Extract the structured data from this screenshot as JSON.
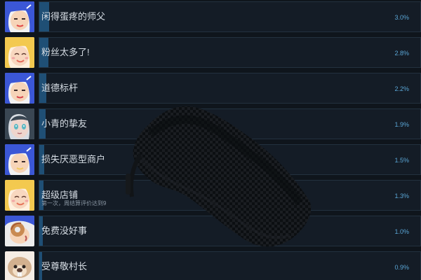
{
  "achievements": [
    {
      "title": "闲得蛋疼的师父",
      "description": "",
      "percent_label": "3.0%",
      "percent": 3.0,
      "avatar_icon": "blue-hair-girl-avatar",
      "hair_color": "#3b57d6",
      "skin_color": "#f6d4b8",
      "accent_color": "#e04646"
    },
    {
      "title": "粉丝太多了!",
      "description": "",
      "percent_label": "2.8%",
      "percent": 2.8,
      "avatar_icon": "blonde-girl-avatar",
      "hair_color": "#f3c94f",
      "skin_color": "#f8d7bf",
      "accent_color": "#e46a5a"
    },
    {
      "title": "道德标杆",
      "description": "",
      "percent_label": "2.2%",
      "percent": 2.2,
      "avatar_icon": "blue-hair-girl-avatar",
      "hair_color": "#3b57d6",
      "skin_color": "#f6d4b8",
      "accent_color": "#d8414a"
    },
    {
      "title": "小青的挚友",
      "description": "",
      "percent_label": "1.9%",
      "percent": 1.9,
      "avatar_icon": "dark-hair-girl-avatar",
      "hair_color": "#3a4753",
      "skin_color": "#efd6cd",
      "accent_color": "#5cb8c3"
    },
    {
      "title": "损失厌恶型商户",
      "description": "",
      "percent_label": "1.5%",
      "percent": 1.5,
      "avatar_icon": "blue-hair-girl-avatar",
      "hair_color": "#3b57d6",
      "skin_color": "#f6d4b8",
      "accent_color": "#f2c95e"
    },
    {
      "title": "超级店铺",
      "description": "第一次，周结算评价达到9",
      "percent_label": "1.3%",
      "percent": 1.3,
      "avatar_icon": "blonde-girl-avatar",
      "hair_color": "#f3c94f",
      "skin_color": "#f8d7bf",
      "accent_color": "#e5745a"
    },
    {
      "title": "免费没好事",
      "description": "",
      "percent_label": "1.0%",
      "percent": 1.0,
      "avatar_icon": "donut-avatar",
      "hair_color": "#3b57d6",
      "skin_color": "#f6d4b8",
      "accent_color": "#c96a3e"
    },
    {
      "title": "受尊敬村长",
      "description": "",
      "percent_label": "0.9%",
      "percent": 0.9,
      "avatar_icon": "beaver-avatar",
      "hair_color": "#d2b08f",
      "skin_color": "#f3dfc8",
      "accent_color": "#ffffff"
    }
  ],
  "overlay_icon": "dark-cloth-overlay"
}
